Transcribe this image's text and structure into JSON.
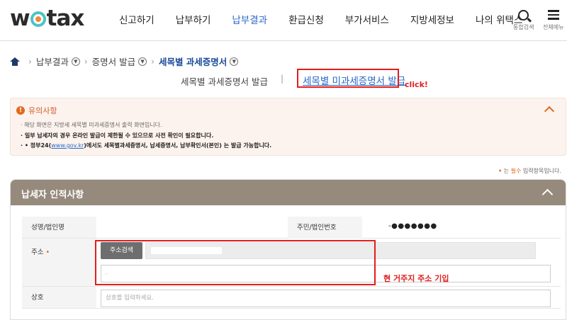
{
  "header": {
    "logo": "wetax",
    "nav": [
      "신고하기",
      "납부하기",
      "납부결과",
      "환급신청",
      "부가서비스",
      "지방세정보",
      "나의 위택스"
    ],
    "active_nav": "납부결과",
    "search_label": "통합검색",
    "menu_label": "전체메뉴"
  },
  "breadcrumb": {
    "items": [
      "납부결과",
      "증명서 발급",
      "세목별 과세증명서"
    ]
  },
  "subtabs": {
    "tab1": "세목별 과세증명서 발급",
    "separator": "|",
    "tab2": "세목별 미과세증명서 발급",
    "annotation": "click!"
  },
  "notice": {
    "title": "유의사항",
    "items": [
      "해당 화면은 지방세 세목별 미과세증명서 출력 화면입니다.",
      "일부 납세자의 경우 온라인 발급이 제한될 수 있으므로 사전 확인이 필요합니다.",
      "정부24(",
      "www.gov.kr",
      ")에서도 세목별과세증명서, 납세증명서, 납부확인서(본인) 는 발급 가능합니다."
    ]
  },
  "required_note": {
    "dot": "•",
    "prefix": "는 ",
    "em": "필수",
    "suffix": " 입력항목입니다."
  },
  "panel": {
    "title": "납세자 인적사항",
    "name_label": "성명/법인명",
    "id_label": "주민/법인번호",
    "id_value": "-●●●●●●●",
    "addr_label": "주소",
    "addr_required": "•",
    "addr_button": "주소검색",
    "addr_detail_placeholder": "-",
    "trade_label": "상호",
    "trade_placeholder": "상호를 입력하세요."
  },
  "annotations": {
    "address_note": "현 거주지 주소 기입",
    "highlight_color": "#e21d1d"
  },
  "colors": {
    "accent": "#2a68c9",
    "panel_header": "#958a7c",
    "notice_bg": "#fdf3ee",
    "warning": "#e26a1e"
  }
}
